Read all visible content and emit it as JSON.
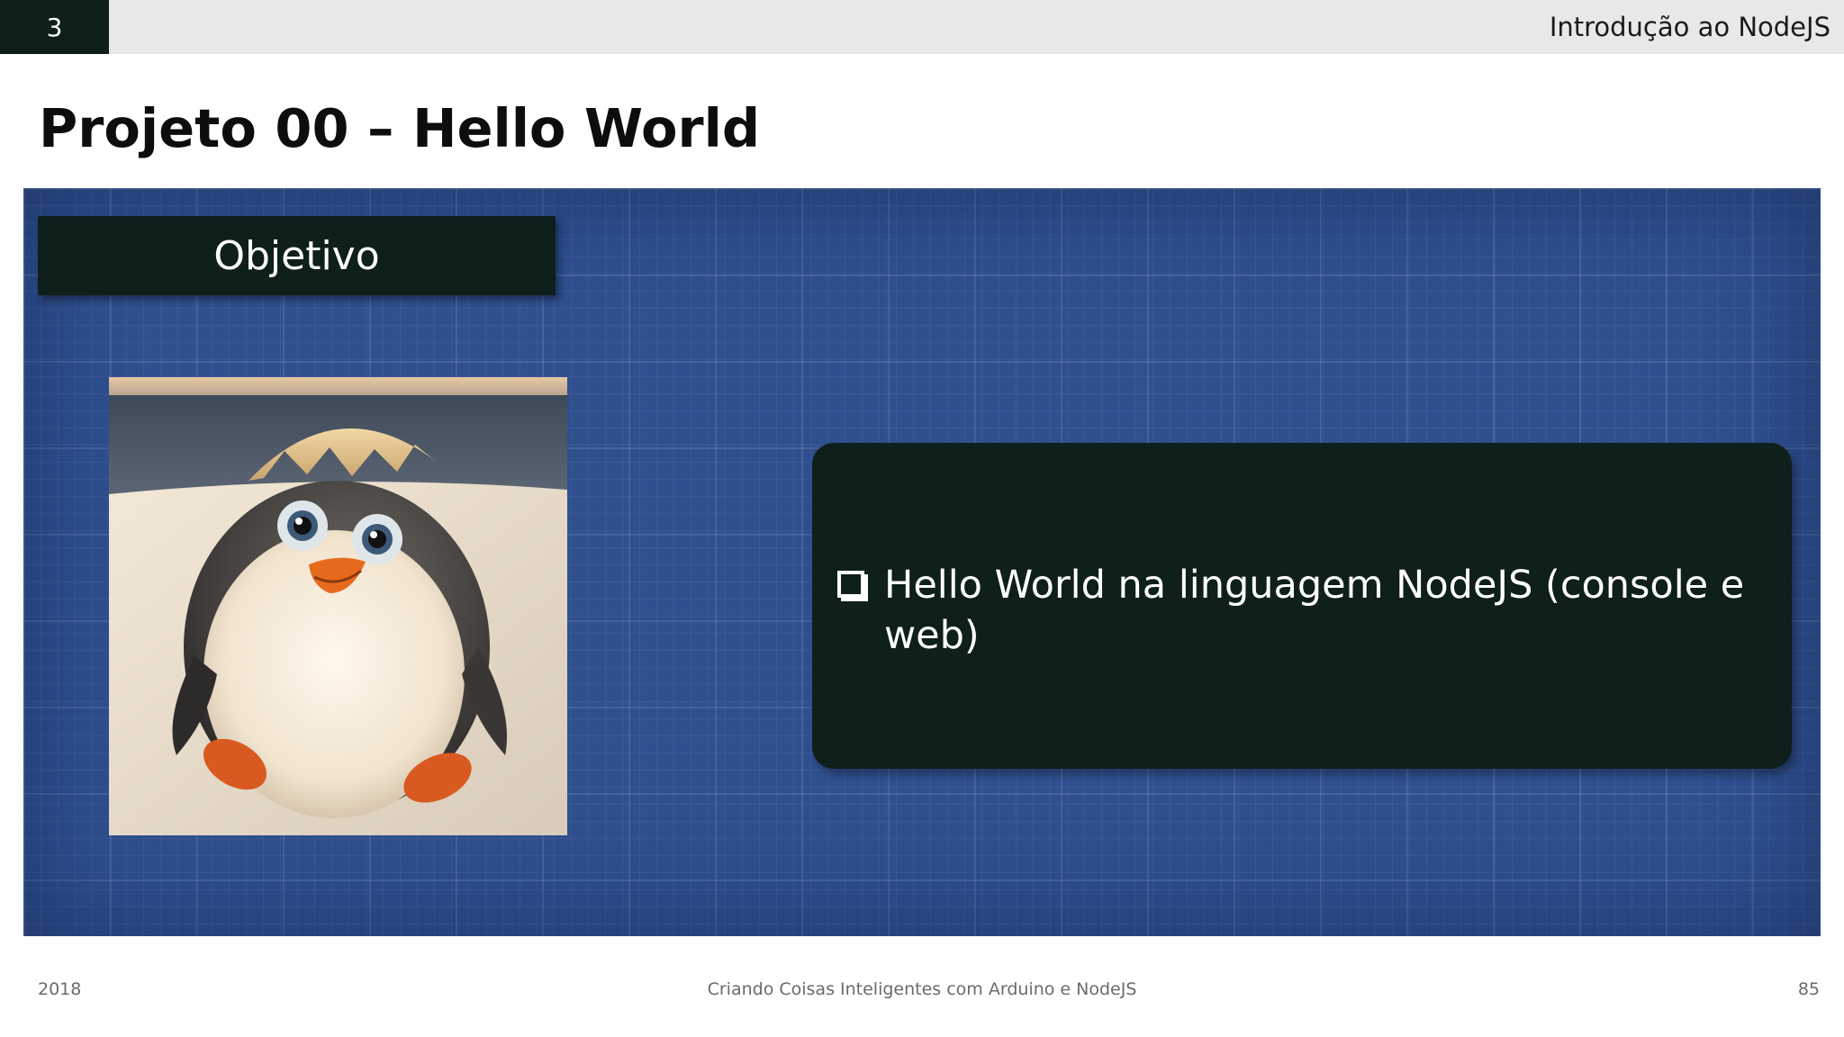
{
  "header": {
    "section_number": "3",
    "course_title": "Introdução ao NodeJS"
  },
  "slide": {
    "title": "Projeto 00 – Hello World",
    "objective_label": "Objetivo",
    "bullets": [
      "Hello World na linguagem NodeJS (console e web)"
    ]
  },
  "image": {
    "subject": "baby penguin hatching from egg shell",
    "icon": "penguin-image"
  },
  "footer": {
    "year": "2018",
    "center_text": "Criando Coisas Inteligentes com Arduino e NodeJS",
    "page_number": "85"
  },
  "colors": {
    "dark_accent": "#0f1f1b",
    "blueprint": "#2f4f8f",
    "header_bar": "#e7e9e8"
  }
}
